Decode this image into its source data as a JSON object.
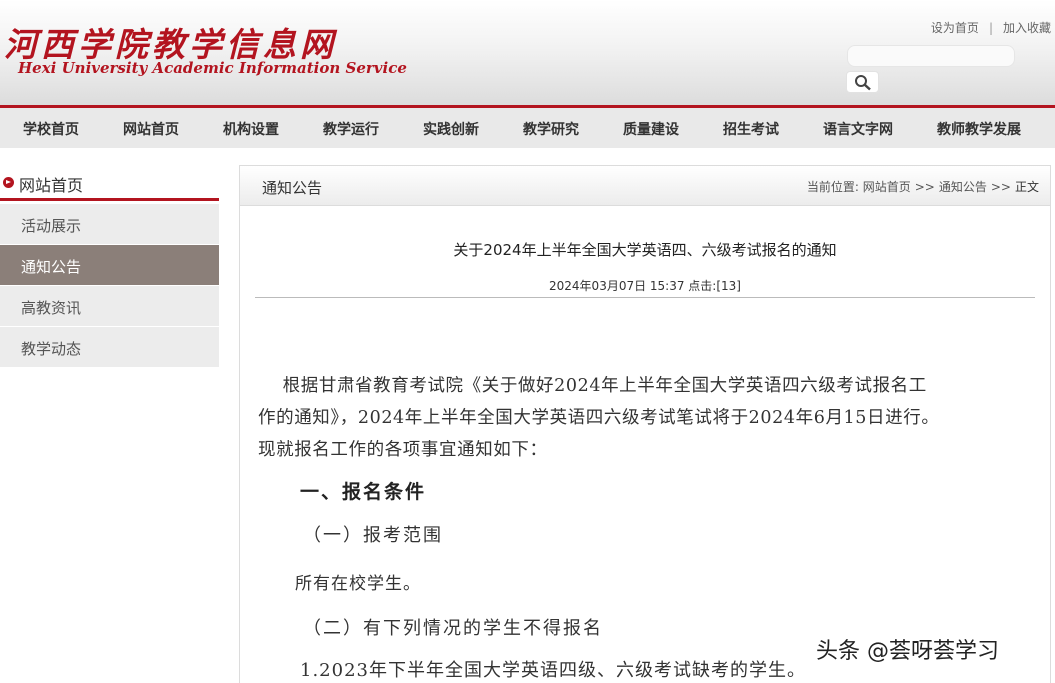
{
  "header": {
    "logo_cn": "河西学院教学信息网",
    "logo_en": "Hexi University Academic Information Service",
    "set_home": "设为首页",
    "separator": "|",
    "add_favorite": "加入收藏",
    "search_placeholder": ""
  },
  "nav": {
    "items": [
      "学校首页",
      "网站首页",
      "机构设置",
      "教学运行",
      "实践创新",
      "教学研究",
      "质量建设",
      "招生考试",
      "语言文字网",
      "教师教学发展"
    ]
  },
  "sidebar": {
    "title": "网站首页",
    "items": [
      {
        "label": "活动展示",
        "active": false
      },
      {
        "label": "通知公告",
        "active": true
      },
      {
        "label": "高教资讯",
        "active": false
      },
      {
        "label": "教学动态",
        "active": false
      }
    ]
  },
  "main": {
    "category": "通知公告",
    "breadcrumb": {
      "prefix": "当前位置:",
      "home": "网站首页",
      "arrow": ">>",
      "section": "通知公告",
      "current": "正文"
    },
    "article": {
      "title": "关于2024年上半年全国大学英语四、六级考试报名的通知",
      "meta": "2024年03月07日 15:37  点击:[13]",
      "para1_line1": "    根据甘肃省教育考试院《关于做好2024年上半年全国大学英语四六级考试报名工",
      "para1_line2": "作的通知》，2024年上半年全国大学英语四六级考试笔试将于2024年6月15日进行。",
      "para1_line3": "现就报名工作的各项事宜通知如下：",
      "heading1": "一、报名条件",
      "sub1": "（一）报考范围",
      "para2": "所有在校学生。",
      "sub2": "（二）有下列情况的学生不得报名",
      "para3": "1.2023年下半年全国大学英语四级、六级考试缺考的学生。"
    }
  },
  "watermark": "头条 @荟呀荟学习",
  "colors": {
    "brand_red": "#b3141f",
    "active_item_bg": "#8b7f79",
    "nav_bg": "#e9e9e9"
  }
}
